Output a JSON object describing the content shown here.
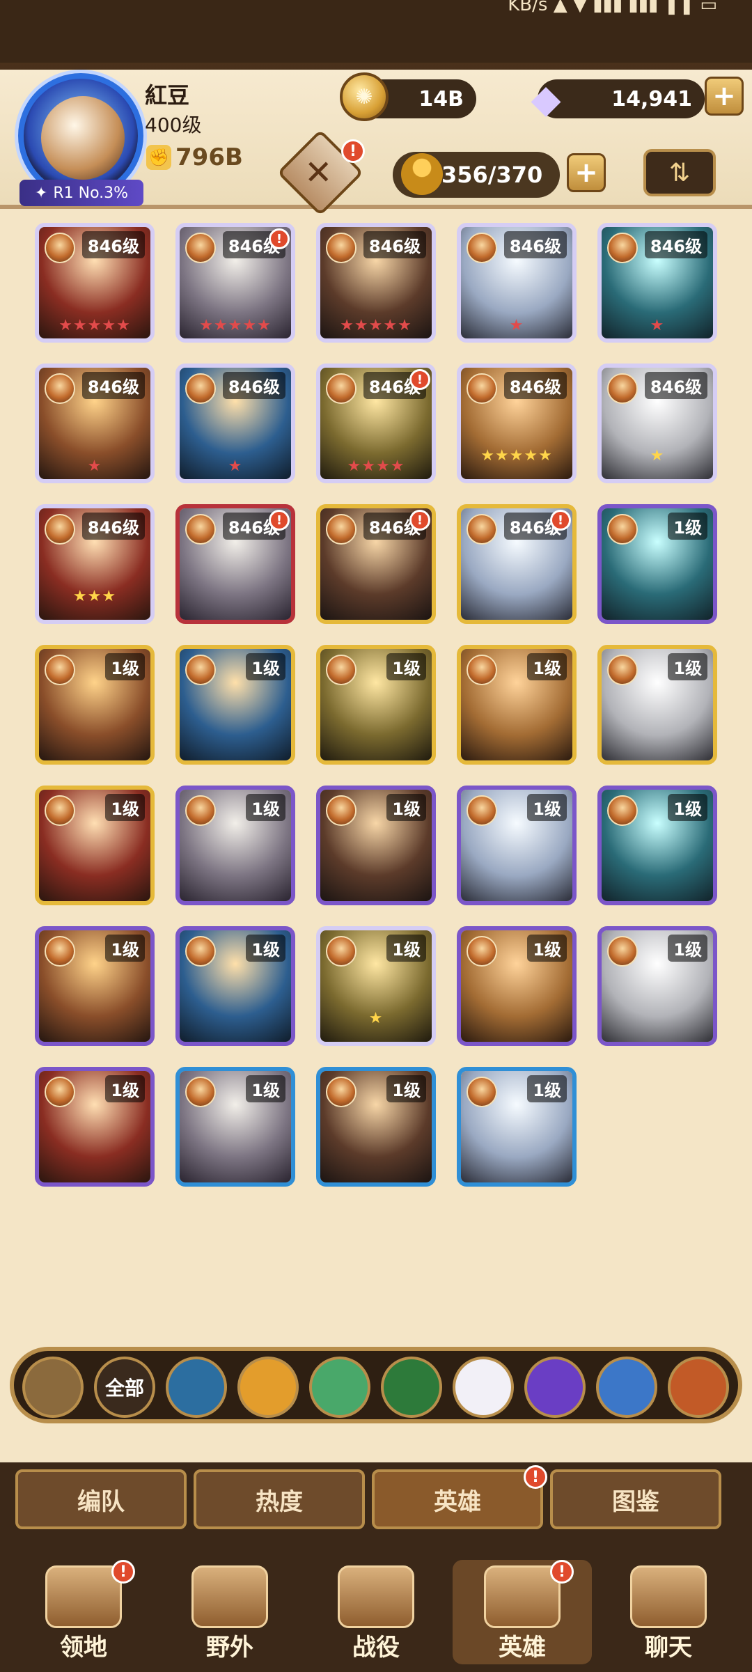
{
  "status_bar": {
    "right_text": "KB/s   ▲  ▼   ▮▮▮  ▮▮▮  ❚❚  ▭"
  },
  "player": {
    "name": "紅豆",
    "level": "400级",
    "power": "796B",
    "rank": "R1 No.3%"
  },
  "currency": {
    "gold": "14B",
    "gems": "14,941"
  },
  "heroes_count": "356/370",
  "heroes": [
    {
      "level": "846级",
      "stars": "★★★★★",
      "star_color": "red",
      "frame": "white",
      "dot": false
    },
    {
      "level": "846级",
      "stars": "★★★★★",
      "star_color": "red",
      "frame": "white",
      "dot": true
    },
    {
      "level": "846级",
      "stars": "★★★★★",
      "star_color": "red",
      "frame": "white",
      "dot": false
    },
    {
      "level": "846级",
      "stars": "★",
      "star_color": "red",
      "frame": "white",
      "dot": false
    },
    {
      "level": "846级",
      "stars": "★",
      "star_color": "red",
      "frame": "white",
      "dot": false
    },
    {
      "level": "846级",
      "stars": "★",
      "star_color": "red",
      "frame": "white",
      "dot": false
    },
    {
      "level": "846级",
      "stars": "★",
      "star_color": "red",
      "frame": "white",
      "dot": false
    },
    {
      "level": "846级",
      "stars": "★★★★",
      "star_color": "red",
      "frame": "white",
      "dot": true
    },
    {
      "level": "846级",
      "stars": "★★★★★",
      "star_color": "gold",
      "frame": "white",
      "dot": false
    },
    {
      "level": "846级",
      "stars": "★",
      "star_color": "gold",
      "frame": "white",
      "dot": false
    },
    {
      "level": "846级",
      "stars": "★★★",
      "star_color": "gold",
      "frame": "white",
      "dot": false
    },
    {
      "level": "846级",
      "stars": "",
      "star_color": "gold",
      "frame": "red",
      "dot": true
    },
    {
      "level": "846级",
      "stars": "",
      "star_color": "gold",
      "frame": "gold",
      "dot": true
    },
    {
      "level": "846级",
      "stars": "",
      "star_color": "gold",
      "frame": "gold",
      "dot": true
    },
    {
      "level": "1级",
      "stars": "",
      "star_color": "gold",
      "frame": "purple",
      "dot": false
    },
    {
      "level": "1级",
      "stars": "",
      "star_color": "gold",
      "frame": "gold",
      "dot": false
    },
    {
      "level": "1级",
      "stars": "",
      "star_color": "gold",
      "frame": "gold",
      "dot": false
    },
    {
      "level": "1级",
      "stars": "",
      "star_color": "gold",
      "frame": "gold",
      "dot": false
    },
    {
      "level": "1级",
      "stars": "",
      "star_color": "gold",
      "frame": "gold",
      "dot": false
    },
    {
      "level": "1级",
      "stars": "",
      "star_color": "gold",
      "frame": "gold",
      "dot": false
    },
    {
      "level": "1级",
      "stars": "",
      "star_color": "gold",
      "frame": "gold",
      "dot": false
    },
    {
      "level": "1级",
      "stars": "",
      "star_color": "gold",
      "frame": "purple",
      "dot": false
    },
    {
      "level": "1级",
      "stars": "",
      "star_color": "gold",
      "frame": "purple",
      "dot": false
    },
    {
      "level": "1级",
      "stars": "",
      "star_color": "gold",
      "frame": "purple",
      "dot": false
    },
    {
      "level": "1级",
      "stars": "",
      "star_color": "gold",
      "frame": "purple",
      "dot": false
    },
    {
      "level": "1级",
      "stars": "",
      "star_color": "gold",
      "frame": "purple",
      "dot": false
    },
    {
      "level": "1级",
      "stars": "",
      "star_color": "gold",
      "frame": "purple",
      "dot": false
    },
    {
      "level": "1级",
      "stars": "★",
      "star_color": "gold",
      "frame": "white",
      "dot": false
    },
    {
      "level": "1级",
      "stars": "",
      "star_color": "gold",
      "frame": "purple",
      "dot": false
    },
    {
      "level": "1级",
      "stars": "",
      "star_color": "gold",
      "frame": "purple",
      "dot": false
    },
    {
      "level": "1级",
      "stars": "",
      "star_color": "gold",
      "frame": "purple",
      "dot": false
    },
    {
      "level": "1级",
      "stars": "",
      "star_color": "gold",
      "frame": "blue",
      "dot": false
    },
    {
      "level": "1级",
      "stars": "",
      "star_color": "gold",
      "frame": "blue",
      "dot": false
    },
    {
      "level": "1级",
      "stars": "",
      "star_color": "gold",
      "frame": "blue",
      "dot": false
    }
  ],
  "filters": [
    {
      "name": "upgrade",
      "label": "",
      "color": "#8b6a3d"
    },
    {
      "name": "all",
      "label": "全部",
      "color": "#3a2a1d"
    },
    {
      "name": "lightbearers",
      "label": "",
      "color": "#2c6ea0"
    },
    {
      "name": "mauler",
      "label": "",
      "color": "#e39d2c"
    },
    {
      "name": "wilder",
      "label": "",
      "color": "#49a86a"
    },
    {
      "name": "graveborn",
      "label": "",
      "color": "#2d7a3a"
    },
    {
      "name": "celestial",
      "label": "",
      "color": "#f2f0f7"
    },
    {
      "name": "hypogean",
      "label": "",
      "color": "#6a3ec4"
    },
    {
      "name": "dimensional",
      "label": "",
      "color": "#3c77c8"
    },
    {
      "name": "faction",
      "label": "",
      "color": "#c25a27"
    }
  ],
  "tabs": [
    {
      "label": "编队",
      "active": false,
      "dot": false
    },
    {
      "label": "热度",
      "active": false,
      "dot": false
    },
    {
      "label": "英雄",
      "active": true,
      "dot": true
    },
    {
      "label": "图鉴",
      "active": false,
      "dot": false
    }
  ],
  "nav": [
    {
      "label": "领地",
      "dot": true,
      "active": false
    },
    {
      "label": "野外",
      "dot": false,
      "active": false
    },
    {
      "label": "战役",
      "dot": false,
      "active": false
    },
    {
      "label": "英雄",
      "dot": true,
      "active": true
    },
    {
      "label": "聊天",
      "dot": false,
      "active": false
    }
  ]
}
